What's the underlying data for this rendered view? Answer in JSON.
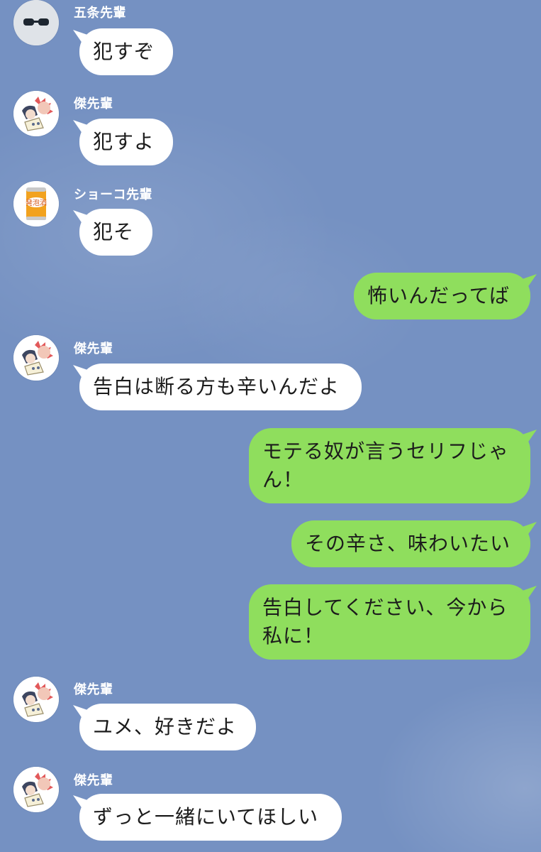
{
  "messages": [
    {
      "sender": "五条先輩",
      "avatar": "sunglasses-avatar-icon",
      "text": "犯すぞ"
    },
    {
      "sender": "傑先輩",
      "avatar": "anime-character-avatar-icon",
      "text": "犯すよ"
    },
    {
      "sender": "ショーコ先輩",
      "avatar": "beer-can-avatar-icon",
      "avatar_label": "発泡酒",
      "text": "犯そ"
    },
    {
      "sender": "me",
      "text": "怖いんだってば"
    },
    {
      "sender": "傑先輩",
      "avatar": "anime-character-avatar-icon",
      "text": "告白は断る方も辛いんだよ"
    },
    {
      "sender": "me",
      "text_line1": "モテる奴が言うセリフじゃ",
      "text_line2": "ん！"
    },
    {
      "sender": "me",
      "text": "その辛さ、味わいたい"
    },
    {
      "sender": "me",
      "text_line1": "告白してください、今から",
      "text_line2": "私に！"
    },
    {
      "sender": "傑先輩",
      "avatar": "anime-character-avatar-icon",
      "text": "ユメ、好きだよ"
    },
    {
      "sender": "傑先輩",
      "avatar": "anime-character-avatar-icon",
      "text": "ずっと一緒にいてほしい"
    }
  ],
  "colors": {
    "background": "#7591c2",
    "incoming_bubble": "#ffffff",
    "outgoing_bubble": "#8fde5d",
    "sender_name": "#ffffff"
  }
}
